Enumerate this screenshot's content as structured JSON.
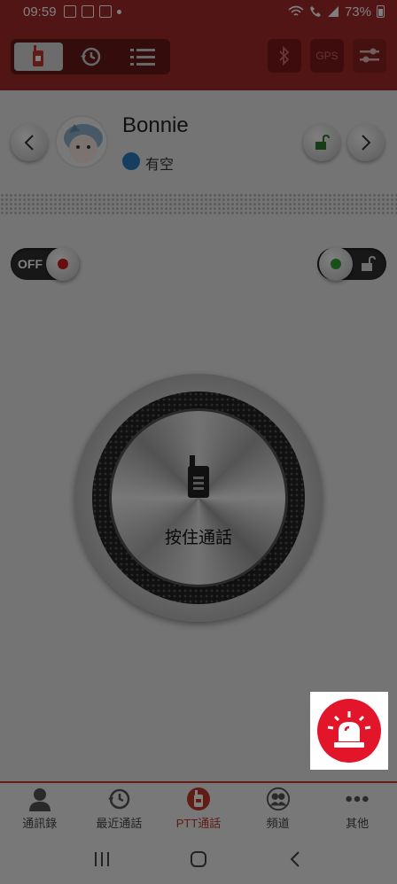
{
  "status_bar": {
    "time": "09:59",
    "battery": "73%"
  },
  "toolbar": {
    "tabs": [
      {
        "name": "ptt",
        "icon": "walkie-talkie-icon",
        "active": true
      },
      {
        "name": "history",
        "icon": "history-icon",
        "active": false
      },
      {
        "name": "list",
        "icon": "list-icon",
        "active": false
      }
    ],
    "bluetooth_icon": "bluetooth-icon",
    "gps_label": "GPS",
    "settings_icon": "sliders-icon"
  },
  "contact": {
    "name": "Bonnie",
    "status": "有空",
    "status_color": "#2a7dc0"
  },
  "toggles": {
    "left_label": "OFF",
    "left_led_color": "#d21c1c",
    "right_led_color": "#2fa32f"
  },
  "ptt": {
    "label": "按住通話"
  },
  "tabbar": {
    "items": [
      {
        "label": "通訊錄",
        "icon": "person-icon"
      },
      {
        "label": "最近通話",
        "icon": "history-icon"
      },
      {
        "label": "PTT通話",
        "icon": "walkie-talkie-icon",
        "active": true
      },
      {
        "label": "頻道",
        "icon": "group-icon"
      },
      {
        "label": "其他",
        "icon": "more-icon"
      }
    ]
  },
  "emergency": {
    "icon": "siren-icon",
    "color": "#e2152b"
  },
  "colors": {
    "brand": "#a52a2a",
    "accent": "#c0392b"
  }
}
